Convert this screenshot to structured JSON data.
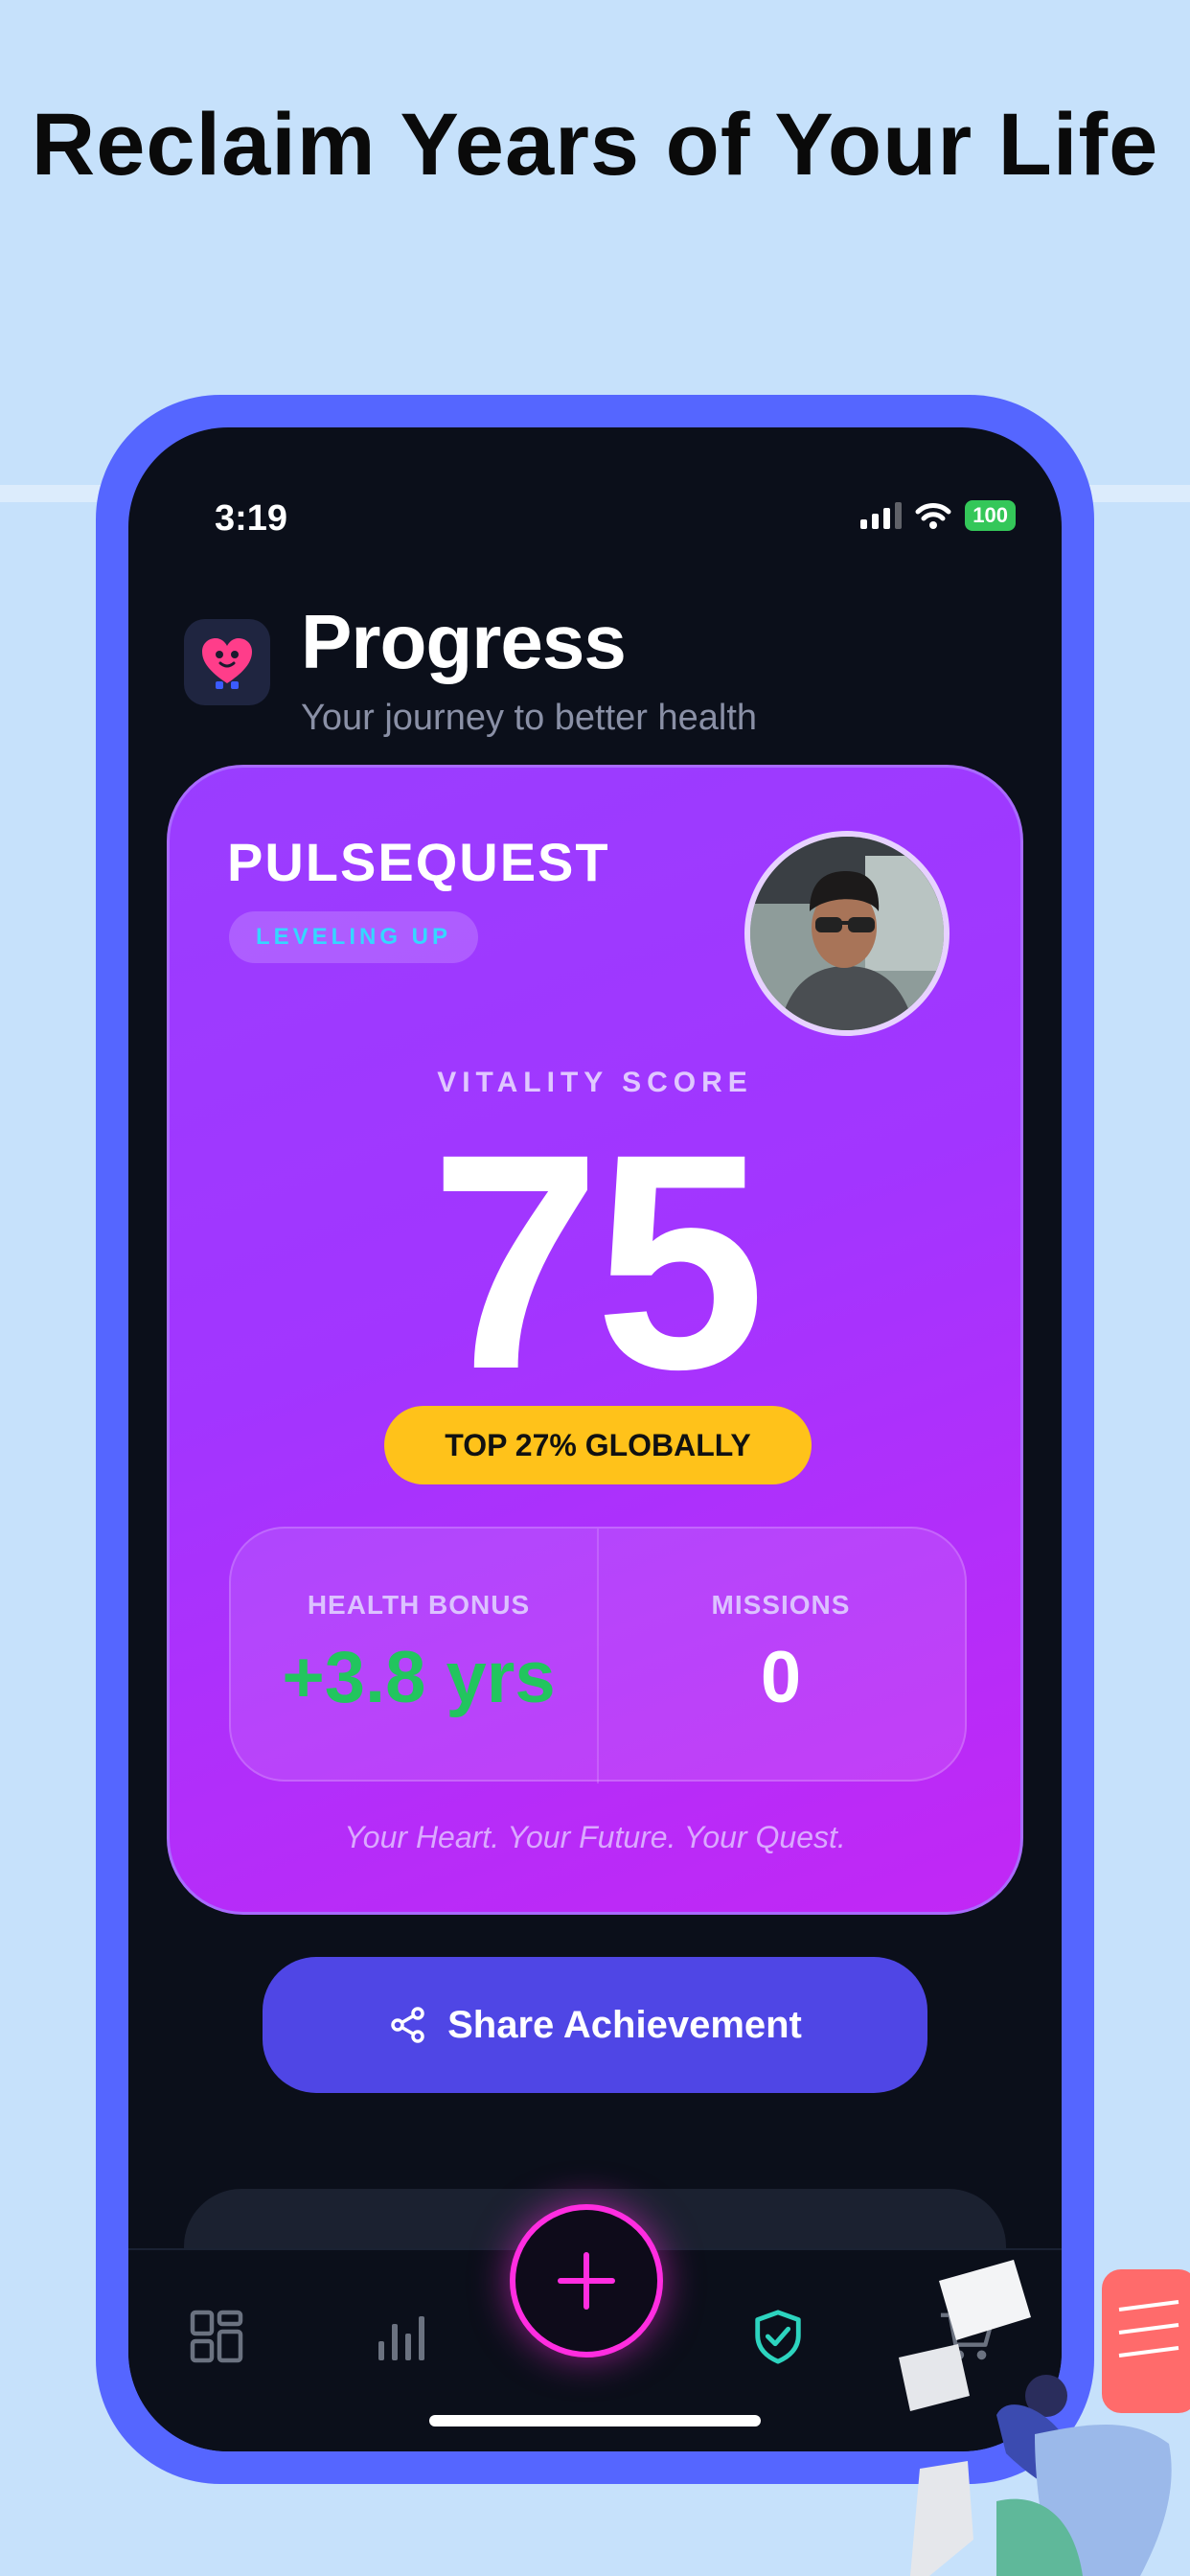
{
  "headline": "Reclaim Years of Your Life",
  "status_bar": {
    "time": "3:19",
    "battery": "100"
  },
  "header": {
    "title": "Progress",
    "subtitle": "Your journey to better health"
  },
  "card": {
    "brand": "PULSEQUEST",
    "level_badge": "LEVELING UP",
    "score_label": "VITALITY SCORE",
    "score": "75",
    "rank": "TOP 27% GLOBALLY",
    "stats": [
      {
        "label": "HEALTH BONUS",
        "value": "+3.8 yrs",
        "color": "#22c55e"
      },
      {
        "label": "MISSIONS",
        "value": "0",
        "color": "#ffffff"
      }
    ],
    "tagline": "Your Heart. Your Future. Your Quest."
  },
  "share_button": {
    "label": "Share Achievement",
    "icon": "share-icon"
  },
  "tab_bar": {
    "items": [
      {
        "icon": "grid-icon",
        "active": false
      },
      {
        "icon": "bar-chart-icon",
        "active": false
      },
      {
        "icon": "plus-icon",
        "active": false
      },
      {
        "icon": "shield-check-icon",
        "active": true
      },
      {
        "icon": "cart-icon",
        "active": false
      }
    ]
  },
  "colors": {
    "phone_frame": "#5566ff",
    "card_gradient_start": "#9a3dff",
    "card_gradient_end": "#c227f5",
    "rank_badge": "#ffc21a",
    "share_button": "#4f46e5",
    "fab_ring": "#ff2de0",
    "active_tab": "#2dd4bf"
  }
}
